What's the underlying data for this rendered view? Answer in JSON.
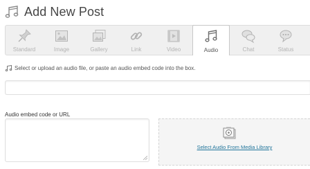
{
  "header": {
    "title": "Add New Post"
  },
  "formats": [
    {
      "label": "Standard",
      "icon": "pushpin-icon"
    },
    {
      "label": "Image",
      "icon": "image-icon"
    },
    {
      "label": "Gallery",
      "icon": "gallery-icon"
    },
    {
      "label": "Link",
      "icon": "link-icon"
    },
    {
      "label": "Video",
      "icon": "film-icon"
    },
    {
      "label": "Audio",
      "icon": "music-note-icon"
    },
    {
      "label": "Chat",
      "icon": "chat-bubbles-icon"
    },
    {
      "label": "Status",
      "icon": "status-bubble-icon"
    }
  ],
  "active_format": "Audio",
  "hint": {
    "text": "Select or upload an audio file, or paste an audio embed code into the box."
  },
  "embed": {
    "label": "Audio embed code or URL"
  },
  "media": {
    "link": "Select Audio From Media Library",
    "icon": "media-library-icon"
  },
  "colors": {
    "link": "#21759b",
    "toolbar_bg": "#f0f0f0",
    "active_tab": "#ffffff"
  }
}
